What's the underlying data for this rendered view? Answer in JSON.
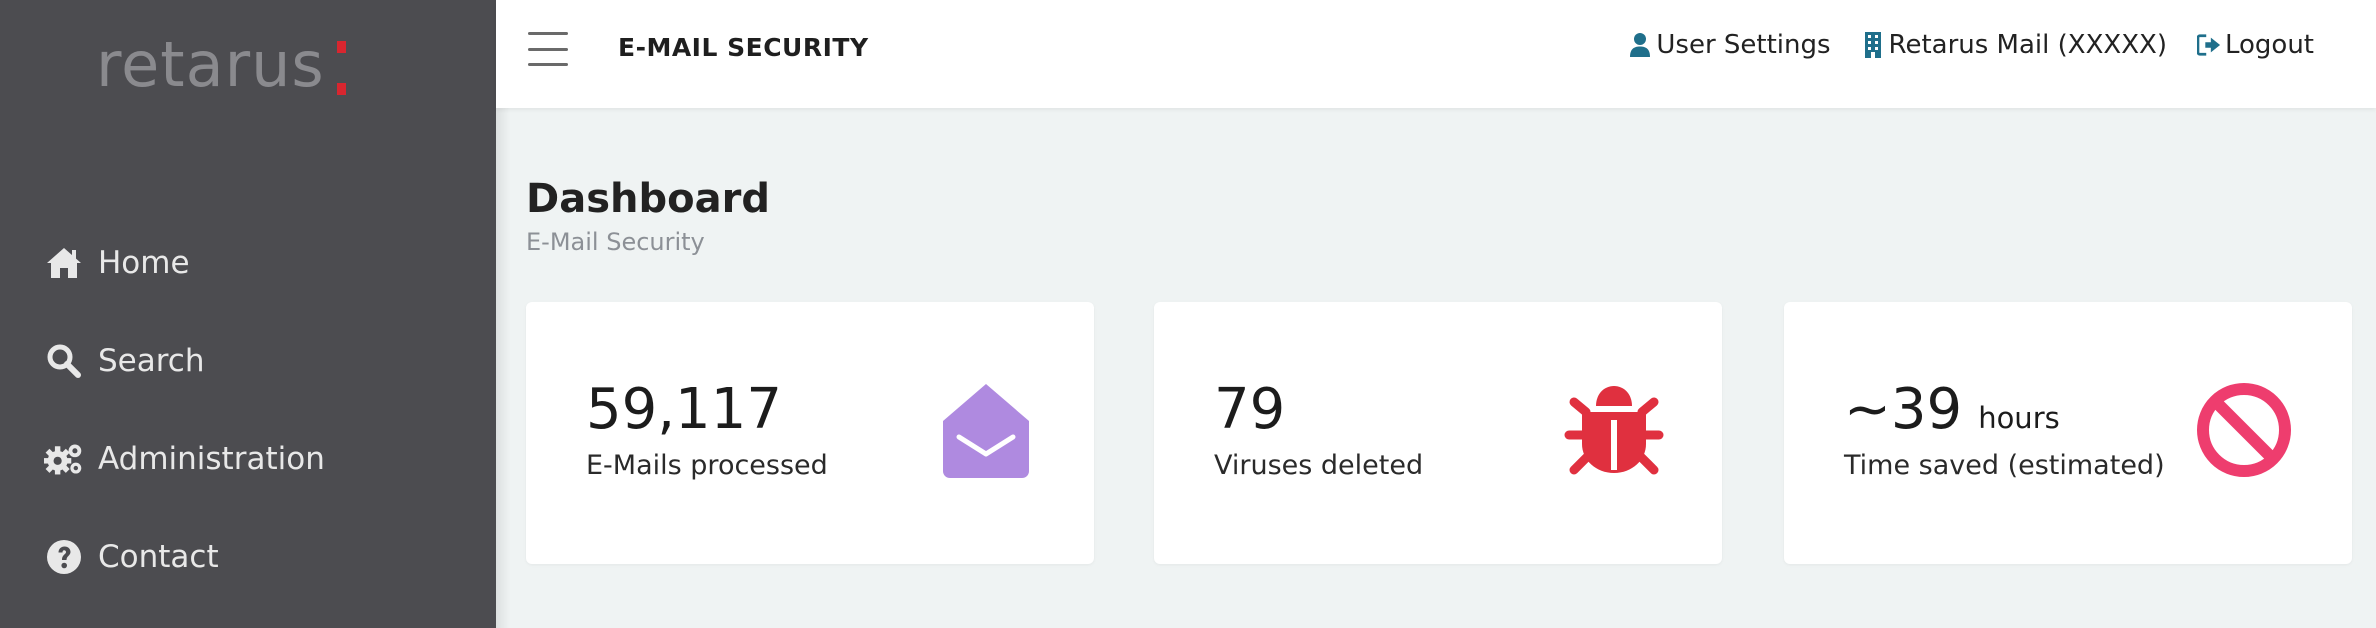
{
  "sidebar": {
    "logo_text": "retarus",
    "brand_color": "#d8262f",
    "items": [
      {
        "label": "Home",
        "icon": "home-icon"
      },
      {
        "label": "Search",
        "icon": "search-icon"
      },
      {
        "label": "Administration",
        "icon": "gears-icon"
      },
      {
        "label": "Contact",
        "icon": "question-circle-icon"
      }
    ]
  },
  "header": {
    "title": "E-MAIL SECURITY",
    "links": [
      {
        "label": "User Settings",
        "icon": "user-icon"
      },
      {
        "label": "Retarus Mail (XXXXX)",
        "icon": "building-icon"
      },
      {
        "label": "Logout",
        "icon": "logout-icon"
      }
    ],
    "icon_color": "#1f6f8b"
  },
  "page": {
    "title": "Dashboard",
    "subtitle": "E-Mail Security"
  },
  "cards": [
    {
      "value": "59,117",
      "unit": "",
      "label": "E-Mails processed",
      "icon": "envelope-open-icon",
      "icon_color": "#af8ae0"
    },
    {
      "value": "79",
      "unit": "",
      "label": "Viruses deleted",
      "icon": "bug-icon",
      "icon_color": "#e0303f"
    },
    {
      "value": "~39",
      "unit": "hours",
      "label": "Time saved (estimated)",
      "icon": "ban-icon",
      "icon_color": "#ee3d6e"
    }
  ]
}
